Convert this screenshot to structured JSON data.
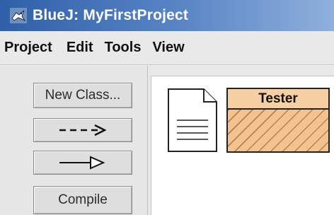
{
  "window": {
    "title": "BlueJ:  MyFirstProject",
    "app_icon": "bluej-bird-icon"
  },
  "menubar": {
    "items": [
      "Project",
      "Edit",
      "Tools",
      "View"
    ]
  },
  "toolbar": {
    "new_class_label": "New Class...",
    "dependency_arrow_label": "--->",
    "inheritance_arrow_label": "—▷",
    "compile_label": "Compile"
  },
  "diagram": {
    "readme_icon": "readme-document-icon",
    "classes": [
      {
        "name": "Tester",
        "uncompiled": true
      }
    ]
  },
  "colors": {
    "title_bar": "#2f5fa8",
    "class_fill": "#f3c28f",
    "class_hatch": "#785028"
  }
}
